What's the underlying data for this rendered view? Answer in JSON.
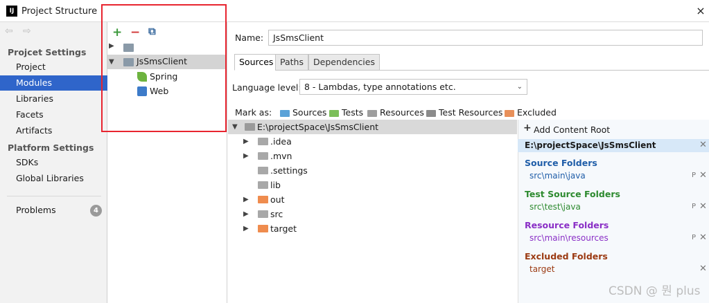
{
  "window": {
    "title": "Project Structure",
    "logo_text": "IJ",
    "close_icon": "×"
  },
  "nav": {
    "back": "⇦",
    "forward": "⇨"
  },
  "sidebar": {
    "project_settings": "Projcet Settings",
    "project": "Project",
    "modules": "Modules",
    "libraries": "Libraries",
    "facets": "Facets",
    "artifacts": "Artifacts",
    "platform_settings": "Platform Settings",
    "sdks": "SDKs",
    "global_libraries": "Global Libraries",
    "problems": "Problems",
    "problems_count": "4"
  },
  "modules_panel": {
    "add": "+",
    "remove": "−",
    "copy": "⧉",
    "module": "JsSmsClient",
    "spring": "Spring",
    "web": "Web"
  },
  "editor": {
    "name_label": "Name:",
    "name_value": "JsSmsClient",
    "tabs": [
      "Sources",
      "Paths",
      "Dependencies"
    ],
    "language_level_label": "Language level:",
    "language_level_value": "8 - Lambdas, type annotations etc.",
    "mark_as_label": "Mark as:",
    "mark_as": [
      "Sources",
      "Tests",
      "Resources",
      "Test Resources",
      "Excluded"
    ]
  },
  "tree": {
    "root": "E:\\projectSpace\\JsSmsClient",
    "children": [
      ".idea",
      ".mvn",
      ".settings",
      "lib",
      "out",
      "src",
      "target"
    ]
  },
  "roots_panel": {
    "add_content_root": "Add Content Root",
    "root_path": "E:\\projectSpace\\JsSmsClient",
    "source_folders": "Source Folders",
    "source_path": "src\\main\\java",
    "test_source_folders": "Test Source Folders",
    "test_path": "src\\test\\java",
    "resource_folders": "Resource Folders",
    "resource_path": "src\\main\\resources",
    "excluded_folders": "Excluded Folders",
    "excluded_path": "target"
  },
  "watermark": "CSDN @ 뭔 plus",
  "colors": {
    "selection": "#2f65ca",
    "sources": "#1f5da8",
    "tests": "#2d8a2f",
    "resources": "#8a2fc6",
    "excluded": "#9b3a12",
    "highlight_box": "#e8242f"
  }
}
